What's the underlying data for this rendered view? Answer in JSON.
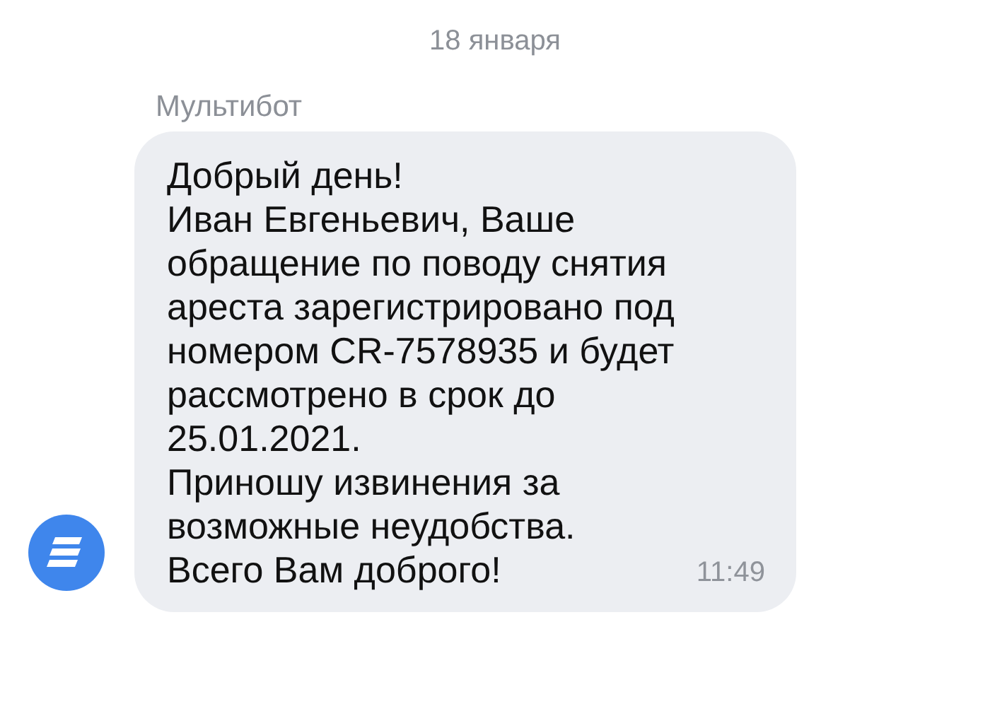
{
  "date_divider": "18 января",
  "sender": "Мультибот",
  "message": {
    "lines": [
      "Добрый день!",
      "Иван Евгеньевич, Ваше",
      "обращение по поводу снятия",
      "ареста зарегистрировано под",
      "номером CR-7578935 и будет",
      "рассмотрено в срок до",
      "25.01.2021.",
      "Приношу извинения за",
      "возможные неудобства.",
      "Всего Вам доброго!"
    ],
    "time": "11:49"
  }
}
